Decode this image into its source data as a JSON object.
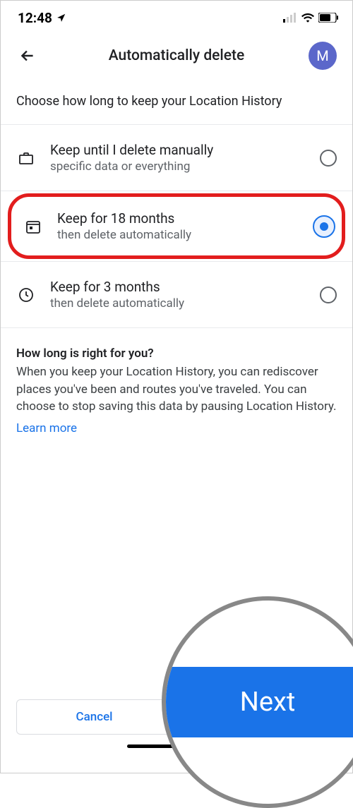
{
  "status": {
    "time": "12:48"
  },
  "header": {
    "title": "Automatically delete",
    "avatar_initial": "M"
  },
  "subtitle": "Choose how long to keep your Location History",
  "options": [
    {
      "title": "Keep until I delete manually",
      "sub": "specific data or everything",
      "icon": "briefcase",
      "selected": false
    },
    {
      "title": "Keep for 18 months",
      "sub": "then delete automatically",
      "icon": "calendar",
      "selected": true
    },
    {
      "title": "Keep for 3 months",
      "sub": "then delete automatically",
      "icon": "clock",
      "selected": false
    }
  ],
  "info": {
    "title": "How long is right for you?",
    "body": "When you keep your Location History, you can rediscover places you've been and routes you've traveled. You can choose to stop saving this data by pausing Location History.",
    "learn_more": "Learn more"
  },
  "buttons": {
    "cancel": "Cancel",
    "next": "Next"
  },
  "zoom": {
    "next": "Next"
  }
}
